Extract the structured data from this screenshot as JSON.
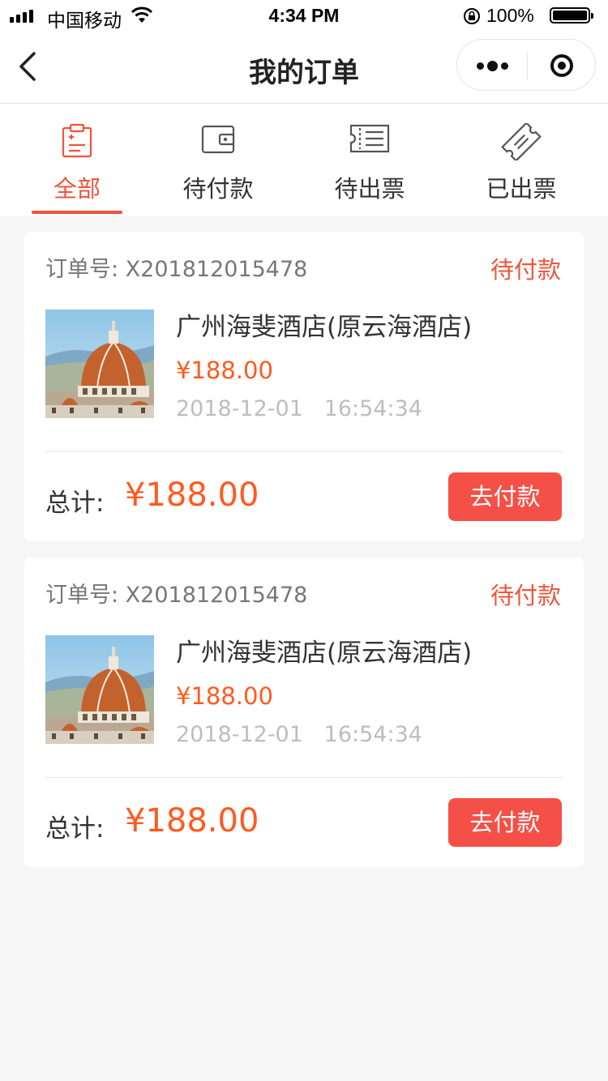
{
  "status_bar": {
    "carrier": "中国移动",
    "time": "4:34 PM",
    "battery": "100%"
  },
  "nav": {
    "title": "我的订单"
  },
  "tabs": [
    {
      "label": "全部",
      "icon": "clipboard-icon",
      "active": true
    },
    {
      "label": "待付款",
      "icon": "wallet-icon",
      "active": false
    },
    {
      "label": "待出票",
      "icon": "ticket-list-icon",
      "active": false
    },
    {
      "label": "已出票",
      "icon": "issued-ticket-icon",
      "active": false
    }
  ],
  "orders": [
    {
      "order_no_label": "订单号: X201812015478",
      "status": "待付款",
      "hotel_name": "广州海斐酒店(原云海酒店)",
      "price": "¥188.00",
      "datetime": "2018-12-01   16:54:34",
      "total_label": "总计:",
      "total_amount": "¥188.00",
      "pay_label": "去付款"
    },
    {
      "order_no_label": "订单号: X201812015478",
      "status": "待付款",
      "hotel_name": "广州海斐酒店(原云海酒店)",
      "price": "¥188.00",
      "datetime": "2018-12-01   16:54:34",
      "total_label": "总计:",
      "total_amount": "¥188.00",
      "pay_label": "去付款"
    }
  ],
  "colors": {
    "accent": "#f0543c",
    "price": "#ff5a1e",
    "pay_button": "#f55047"
  }
}
